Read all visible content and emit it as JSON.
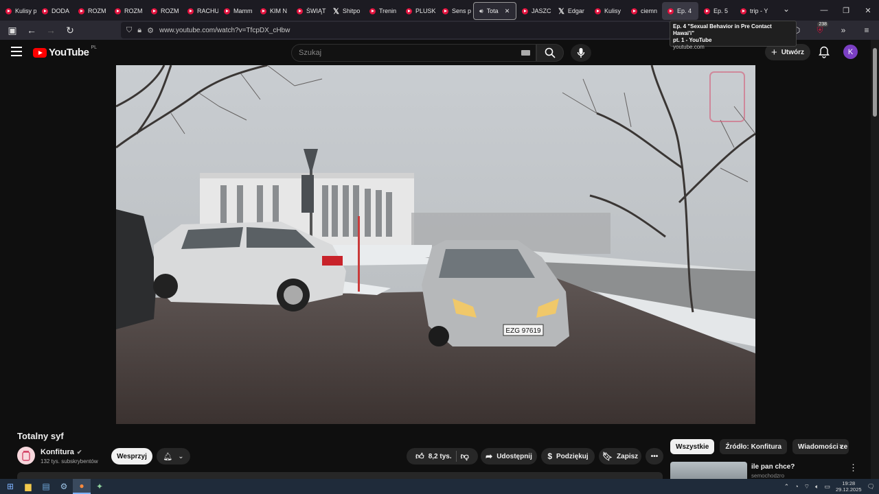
{
  "browser": {
    "tabs": [
      {
        "label": "Kulisy p",
        "icon": "youtube-icon"
      },
      {
        "label": "DODA",
        "icon": "youtube-icon"
      },
      {
        "label": "ROZM",
        "icon": "youtube-icon"
      },
      {
        "label": "ROZM",
        "icon": "youtube-icon"
      },
      {
        "label": "ROZM",
        "icon": "youtube-icon"
      },
      {
        "label": "RACHU",
        "icon": "youtube-icon"
      },
      {
        "label": "Mamm",
        "icon": "youtube-icon"
      },
      {
        "label": "KIM N",
        "icon": "youtube-icon"
      },
      {
        "label": "ŚWIĄT",
        "icon": "youtube-icon"
      },
      {
        "label": "Shitpo",
        "icon": "x-icon"
      },
      {
        "label": "Trenin",
        "icon": "youtube-icon"
      },
      {
        "label": "PLUSK",
        "icon": "youtube-icon"
      },
      {
        "label": "Sens p",
        "icon": "youtube-icon"
      },
      {
        "label": "Tota",
        "icon": "speaker-icon",
        "active": true
      },
      {
        "label": "JASZC",
        "icon": "youtube-icon"
      },
      {
        "label": "Edgar",
        "icon": "x-icon"
      },
      {
        "label": "Kulisy",
        "icon": "youtube-icon"
      },
      {
        "label": "ciemn",
        "icon": "youtube-icon"
      },
      {
        "label": "Ep. 4",
        "icon": "youtube-icon",
        "hover": true
      },
      {
        "label": "Ep. 5",
        "icon": "youtube-icon"
      },
      {
        "label": "trip - Y",
        "icon": "youtube-icon"
      }
    ],
    "url": "www.youtube.com/watch?v=TfcpDX_cHbw",
    "extensions_badge": "238",
    "tooltip": {
      "line1": "Ep. 4 \"Sexual Behavior in Pre Contact Hawai'i\"",
      "line2": "pt. 1 - YouTube",
      "line3": "youtube.com"
    }
  },
  "youtube": {
    "logo_text": "YouTube",
    "logo_country": "PL",
    "search_placeholder": "Szukaj",
    "create_label": "Utwórz",
    "avatar_letter": "K"
  },
  "video": {
    "title": "Totalny syf",
    "plate": "EZG 97619",
    "channel": {
      "name": "Konfitura",
      "subscribers": "132 tys. subskrybentów",
      "support_label": "Wesprzyj"
    },
    "actions": {
      "likes": "8,2 tys.",
      "share": "Udostępnij",
      "thanks": "Podziękuj",
      "save": "Zapisz"
    }
  },
  "sidebar": {
    "chips": [
      "Wszystkie",
      "Źródło: Konfitura",
      "Wiadomości ze"
    ],
    "rec_title": "ile pan chce?",
    "rec_channel": "semochodzro"
  },
  "taskbar": {
    "time": "19:28",
    "date": "29.12.2025"
  }
}
